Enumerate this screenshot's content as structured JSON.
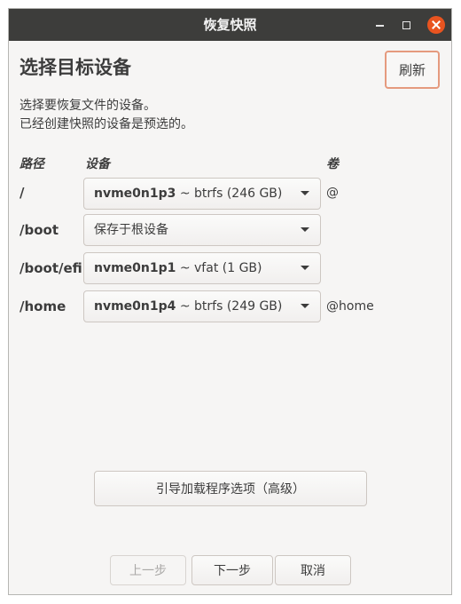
{
  "window": {
    "title": "恢复快照"
  },
  "header": {
    "title": "选择目标设备",
    "refresh_label": "刷新"
  },
  "description": {
    "line1": "选择要恢复文件的设备。",
    "line2": "已经创建快照的设备是预选的。"
  },
  "table": {
    "columns": {
      "path": "路径",
      "device": "设备",
      "volume": "卷"
    },
    "rows": [
      {
        "path": "/",
        "device_name": "nvme0n1p3",
        "device_info": "~ btrfs (246 GB)",
        "volume": "@"
      },
      {
        "path": "/boot",
        "device_name": "",
        "device_info": "保存于根设备",
        "volume": ""
      },
      {
        "path": "/boot/efi",
        "device_name": "nvme0n1p1",
        "device_info": "~ vfat (1 GB)",
        "volume": ""
      },
      {
        "path": "/home",
        "device_name": "nvme0n1p4",
        "device_info": "~ btrfs (249 GB)",
        "volume": "@home"
      }
    ]
  },
  "bootloader_button": "引导加载程序选项（高级）",
  "nav": {
    "prev": "上一步",
    "next": "下一步",
    "cancel": "取消"
  },
  "colors": {
    "titlebar": "#3d3d3b",
    "close": "#e95420",
    "accent_border": "#e59a7e",
    "background": "#f6f5f4"
  }
}
